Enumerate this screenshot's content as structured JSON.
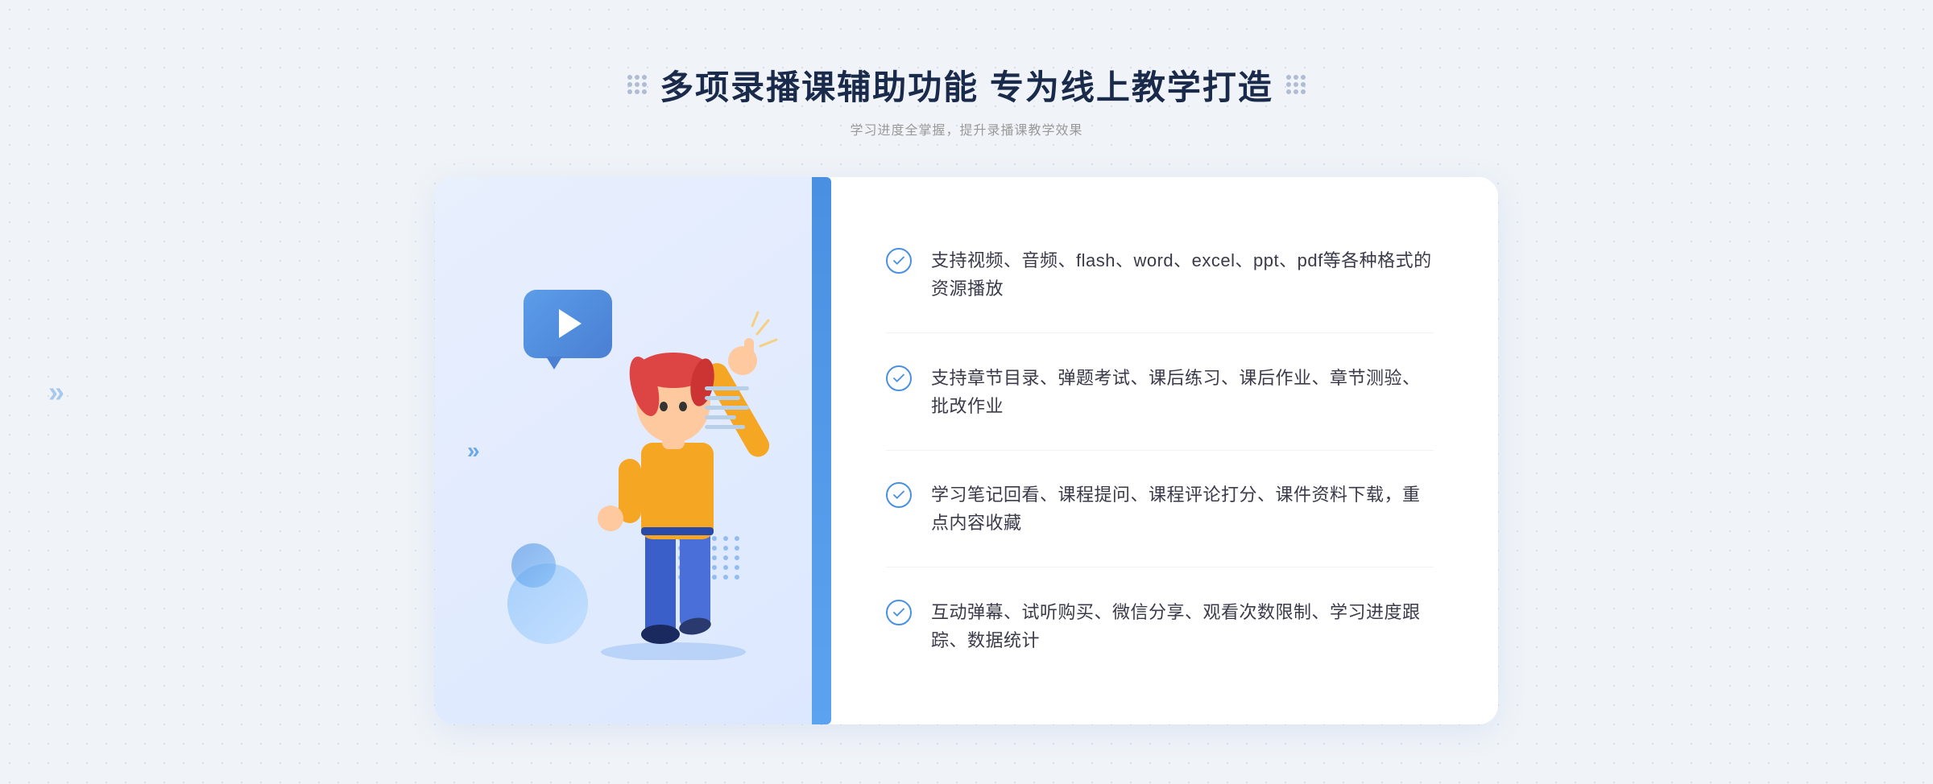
{
  "header": {
    "title": "多项录播课辅助功能 专为线上教学打造",
    "subtitle": "学习进度全掌握，提升录播课教学效果"
  },
  "features": [
    {
      "id": "feature-1",
      "text": "支持视频、音频、flash、word、excel、ppt、pdf等各种格式的资源播放"
    },
    {
      "id": "feature-2",
      "text": "支持章节目录、弹题考试、课后练习、课后作业、章节测验、批改作业"
    },
    {
      "id": "feature-3",
      "text": "学习笔记回看、课程提问、课程评论打分、课件资料下载，重点内容收藏"
    },
    {
      "id": "feature-4",
      "text": "互动弹幕、试听购买、微信分享、观看次数限制、学习进度跟踪、数据统计"
    }
  ],
  "colors": {
    "primary": "#4a90e2",
    "title": "#1a2a4a",
    "text": "#3a3a4a",
    "subtitle": "#999999",
    "bg": "#f0f4f8",
    "card_bg": "#ffffff",
    "left_bg_start": "#e8effd",
    "left_bg_end": "#dce8ff"
  }
}
